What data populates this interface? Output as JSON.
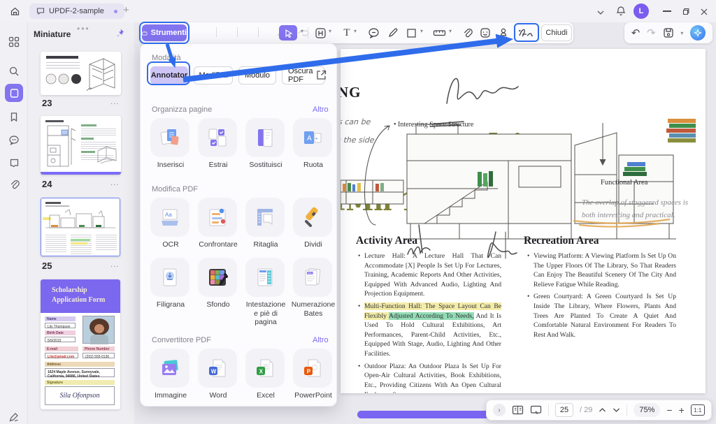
{
  "colors": {
    "accent_purple": "#8374F0",
    "callout_blue": "#2F6CEB",
    "highlight_yellow": "#F3ECA9",
    "highlight_green": "#93DCB6",
    "stamp_olive": "#7D8236"
  },
  "window": {
    "tab_title": "UPDF-2-sample",
    "avatar_initial": "L"
  },
  "sidebar": {
    "title": "Miniature",
    "pages": [
      {
        "num": "23",
        "menu": "..."
      },
      {
        "num": "24",
        "menu": "..."
      },
      {
        "num": "25",
        "menu": "..."
      }
    ],
    "form": {
      "title_line1": "Scholarship",
      "title_line2": "Application Form",
      "name_label": "Name",
      "name_value": "Lily Thompson",
      "birth_label": "Birth Date",
      "birth_value": "5/9/2015",
      "email_label": "E-mail",
      "email_value": "Lila@gmail.com",
      "phone_label": "Phone Number",
      "phone_value": "(202) 555-0136",
      "address_label": "Address",
      "address_value": "1624 Maple Avenue, Sunnyvale, California, 94086, United States",
      "signature_label": "Signature",
      "signature_value": "Sila Ofonpson"
    }
  },
  "toolbar": {
    "tools_label": "Strumenti",
    "close_label": "Chiudi"
  },
  "panel": {
    "mode_label": "Modalità",
    "modes": [
      {
        "label": "Annotator"
      },
      {
        "label": "Modifica"
      },
      {
        "label": "Modulo"
      },
      {
        "label": "Oscura PDF"
      }
    ],
    "sections": [
      {
        "title": "Organizza pagine",
        "more": "Altro",
        "items": [
          {
            "label": "Inserisci"
          },
          {
            "label": "Estrai"
          },
          {
            "label": "Sostituisci"
          },
          {
            "label": "Ruota"
          }
        ]
      },
      {
        "title": "Modifica PDF",
        "more": "",
        "items": [
          {
            "label": "OCR"
          },
          {
            "label": "Confrontare"
          },
          {
            "label": "Ritaglia"
          },
          {
            "label": "Dividi"
          },
          {
            "label": "Filigrana"
          },
          {
            "label": "Sfondo"
          },
          {
            "label": "Intestazione e piè di pagina"
          },
          {
            "label": "Numerazione Bates"
          }
        ]
      },
      {
        "title": "Convertitore PDF",
        "more": "Altro",
        "items": [
          {
            "label": "Immagine"
          },
          {
            "label": "Word"
          },
          {
            "label": "Excel"
          },
          {
            "label": "PowerPoint"
          }
        ]
      }
    ]
  },
  "document": {
    "heading_fragment": "NG",
    "side_note_1": "s can be",
    "side_note_2": "n the side",
    "callout": "Interesting Space Structure",
    "stamp_text_1": "ATmhi",
    "stamp_text_1_sub": "mm,",
    "stamp_text_2": "fMn 1ifl.",
    "functional_label": "Functional Area",
    "margin_note_line1": "The overlap of staggered spaces is",
    "margin_note_line2": "both interesting and practical.",
    "activity": {
      "title": "Activity Area",
      "bullet1": "Lecture Hall: A Lecture Hall That Can Accommodate [X] People Is Set Up For Lectures, Training, Academic Reports And Other Activities, Equipped With Advanced Audio, Lighting And Projection Equipment.",
      "b2_hl_yellow": "Multi-Function Hall: The Space Layout Can Be Flexibly ",
      "b2_hl_green": "Adjusted According To Needs,",
      "b2_rest": " And It Is Used To Hold Cultural Exhibitions, Art Performances, Parent-Child Activities, Etc., Equipped With Stage, Audio, Lighting And Other Facilities.",
      "bullet3": "Outdoor Plaza: An Outdoor Plaza Is Set Up For Open-Air Cultural Activities, Book Exhibitions, Etc., Providing Citizens With An Open Cultural Exchange Space."
    },
    "recreation": {
      "title": "Recreation Area",
      "bullet1": "Viewing Platform: A Viewing Platform Is Set Up On The Upper Floors Of The Library, So That Readers Can Enjoy The Beautiful Scenery Of The City And Relieve Fatigue While Reading.",
      "bullet2": "Green Courtyard: A Green Courtyard Is Set Up Inside The Library, Where Flowers, Plants And Trees Are Planted To Create A Quiet And Comfortable Natural Environment For Readers To Rest And Walk."
    }
  },
  "statusbar": {
    "page_current": "25",
    "page_total": "/ 29",
    "zoom_level": "75%",
    "actual_size": "1:1"
  }
}
